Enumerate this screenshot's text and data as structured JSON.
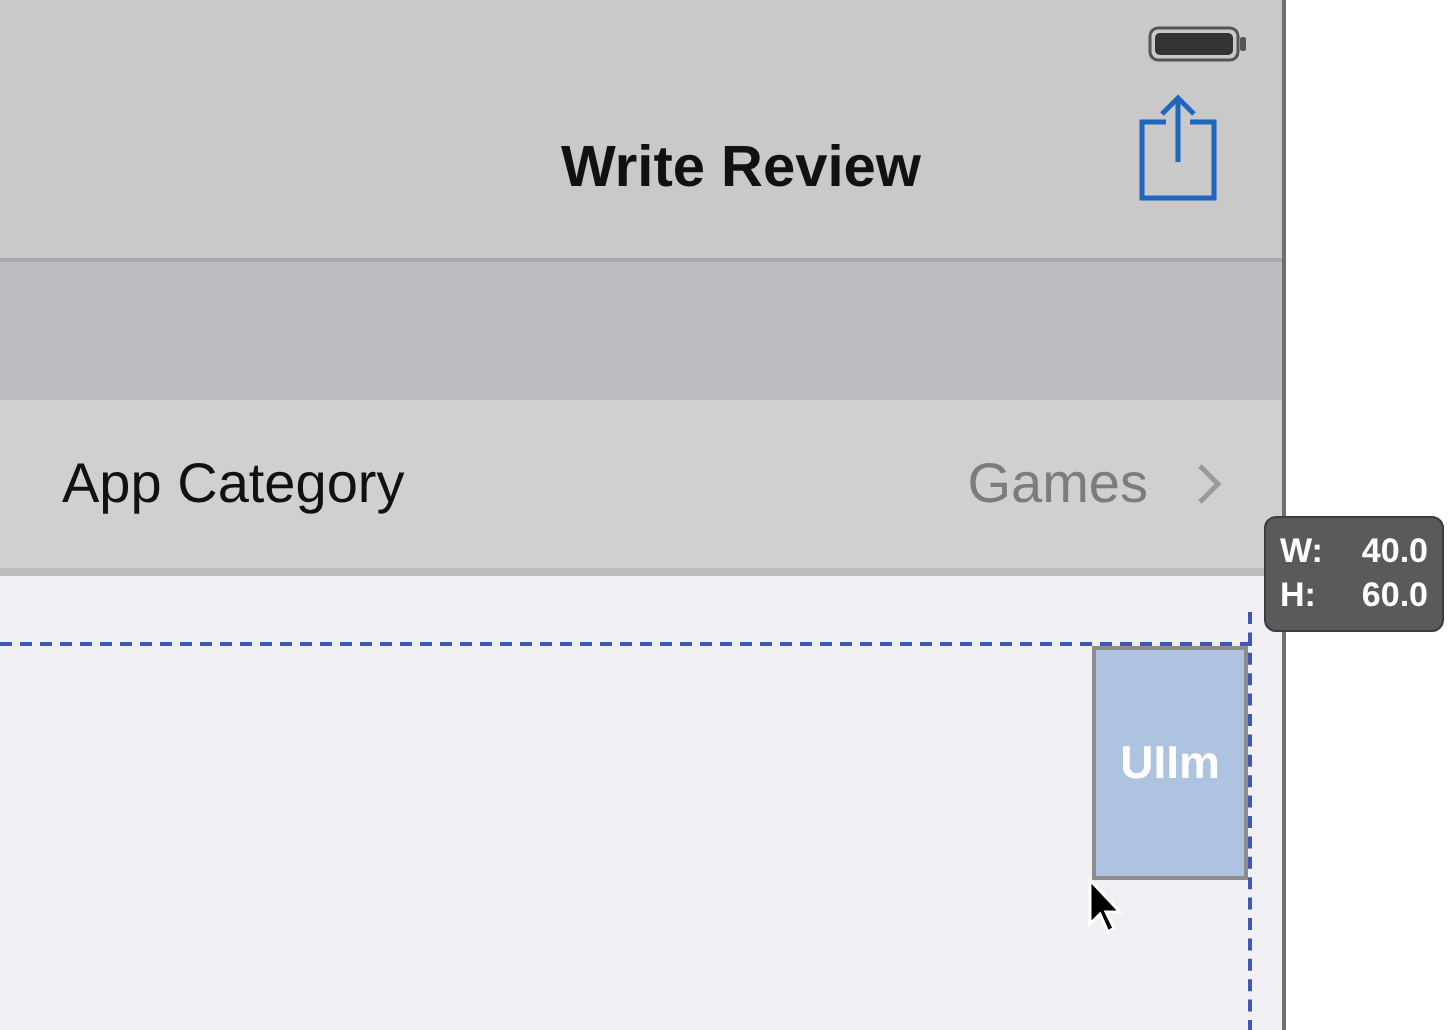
{
  "navigation_bar": {
    "title": "Write Review"
  },
  "category_row": {
    "label": "App Category",
    "value": "Games"
  },
  "image_view": {
    "label": "UIIm"
  },
  "size_tooltip": [
    {
      "key": "W:",
      "value": "40.0"
    },
    {
      "key": "H:",
      "value": "60.0"
    }
  ]
}
